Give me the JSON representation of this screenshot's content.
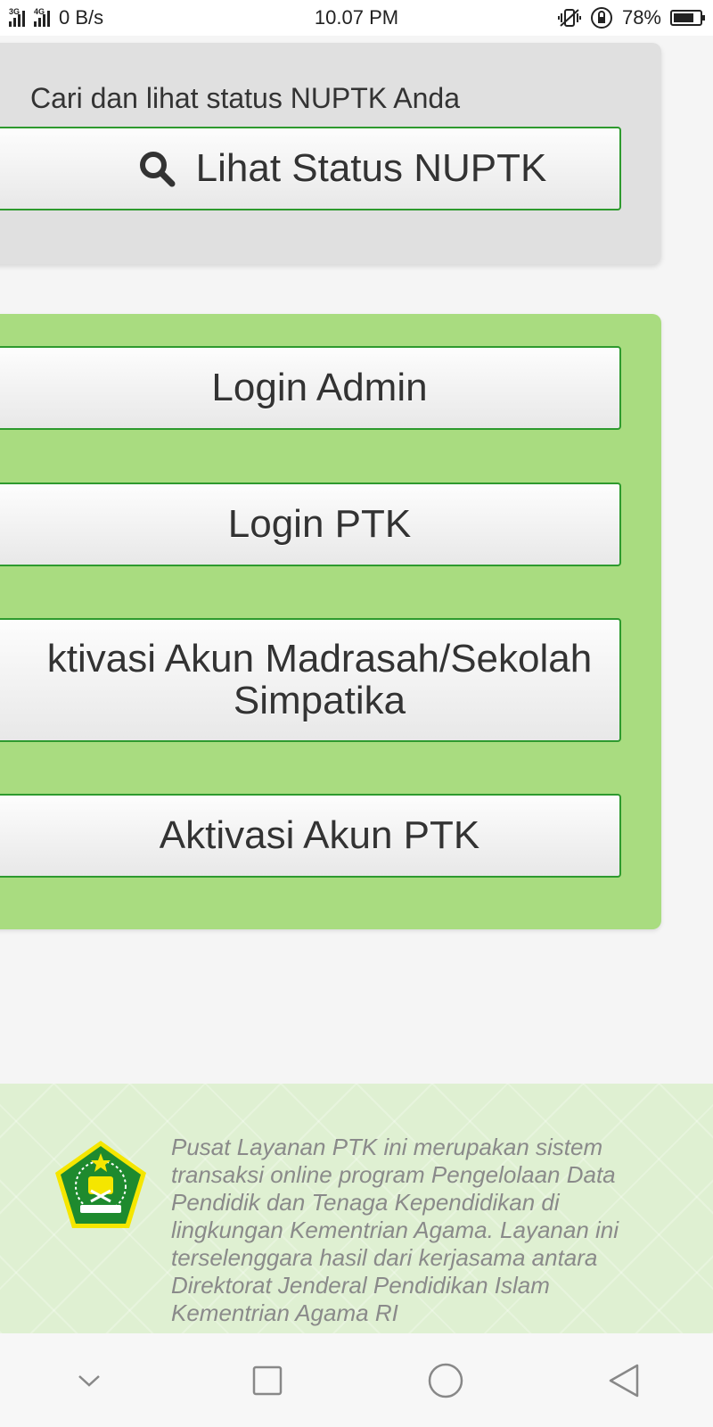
{
  "status_bar": {
    "network_1": "3G",
    "network_2": "4G",
    "speed": "0 B/s",
    "time": "10.07 PM",
    "battery": "78%",
    "battery_level": 0.78
  },
  "status_section": {
    "caption": "Cari dan lihat status NUPTK Anda",
    "button_label": "Lihat Status NUPTK"
  },
  "login_section": {
    "login_admin": "Login Admin",
    "login_ptk": "Login PTK",
    "aktivasi_madrasah_line1": "ktivasi Akun Madrasah/Sekolah",
    "aktivasi_madrasah_line2": "Simpatika",
    "aktivasi_ptk": "Aktivasi Akun PTK"
  },
  "footer": {
    "description": "Pusat Layanan PTK ini merupakan sistem transaksi online program Pengelolaan Data Pendidik dan Tenaga Kependidikan di lingkungan Kementrian Agama. Layanan ini terselenggara hasil dari kerjasama antara Direktorat Jenderal Pendidikan Islam Kementrian Agama RI"
  },
  "colors": {
    "accent_green": "#a9dc80",
    "button_border": "#2e9a2e",
    "card_grey": "#e0e0e0"
  },
  "nav_icons": [
    "chevron-down-icon",
    "square-icon",
    "circle-icon",
    "back-triangle-icon"
  ]
}
